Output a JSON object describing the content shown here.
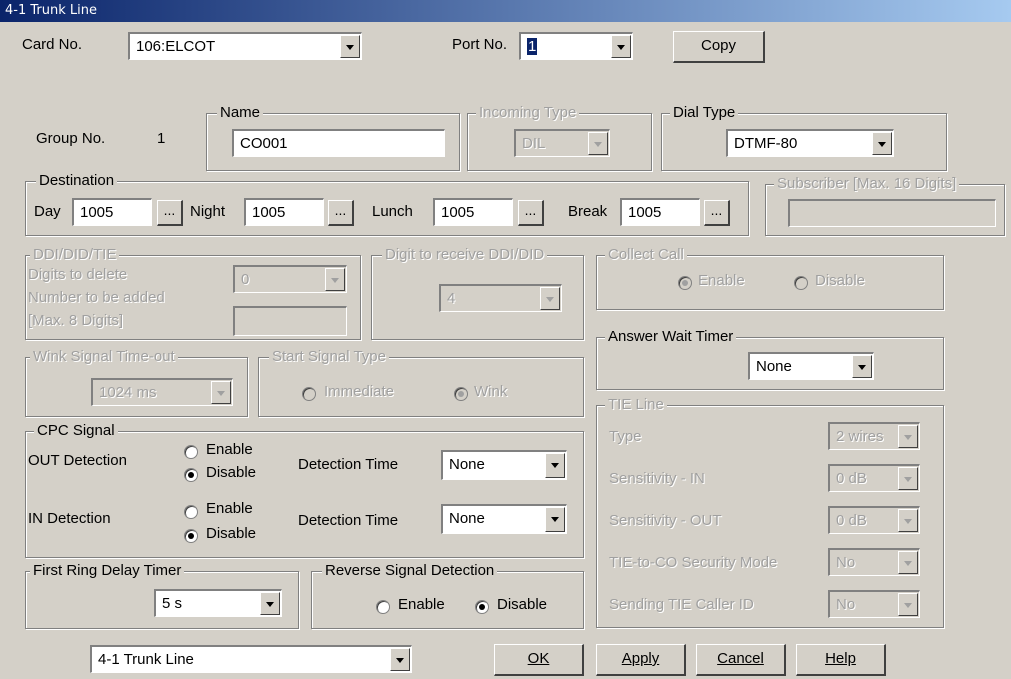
{
  "window": {
    "title": "4-1 Trunk Line"
  },
  "header": {
    "card_label": "Card No.",
    "card_value": "106:ELCOT",
    "port_label": "Port No.",
    "port_value": "1",
    "copy_label": "Copy",
    "group_label": "Group No.",
    "group_value": "1",
    "name_legend": "Name",
    "name_value": "CO001",
    "incoming_legend": "Incoming Type",
    "incoming_value": "DIL",
    "dialtype_legend": "Dial Type",
    "dialtype_value": "DTMF-80"
  },
  "destination": {
    "legend": "Destination",
    "day_label": "Day",
    "day_value": "1005",
    "night_label": "Night",
    "night_value": "1005",
    "lunch_label": "Lunch",
    "lunch_value": "1005",
    "break_label": "Break",
    "break_value": "1005",
    "browse_label": "..."
  },
  "subscriber": {
    "legend": "Subscriber [Max. 16 Digits]",
    "value": ""
  },
  "ddi": {
    "legend": "DDI/DID/TIE",
    "delete_label": "Digits to delete",
    "delete_value": "0",
    "add_label": "Number to be added",
    "add_label2": "[Max. 8 Digits]",
    "add_value": ""
  },
  "digit_receive": {
    "legend": "Digit to receive DDI/DID",
    "value": "4"
  },
  "collect_call": {
    "legend": "Collect Call",
    "enable": "Enable",
    "disable": "Disable"
  },
  "answer_wait": {
    "legend": "Answer Wait Timer",
    "value": "None"
  },
  "wink": {
    "legend": "Wink Signal Time-out",
    "value": "1024 ms"
  },
  "start_signal": {
    "legend": "Start Signal Type",
    "immediate": "Immediate",
    "wink": "Wink"
  },
  "cpc": {
    "legend": "CPC Signal",
    "out_label": "OUT Detection",
    "in_label": "IN Detection",
    "enable": "Enable",
    "disable": "Disable",
    "time_label": "Detection Time",
    "out_time": "None",
    "in_time": "None"
  },
  "tie_line": {
    "legend": "TIE Line",
    "type_label": "Type",
    "type_value": "2 wires",
    "sens_in_label": "Sensitivity - IN",
    "sens_in_value": "0 dB",
    "sens_out_label": "Sensitivity - OUT",
    "sens_out_value": "0 dB",
    "security_label": "TIE-to-CO Security Mode",
    "security_value": "No",
    "callerid_label": "Sending TIE Caller ID",
    "callerid_value": "No"
  },
  "first_ring": {
    "legend": "First Ring Delay Timer",
    "value": "5 s"
  },
  "reverse": {
    "legend": "Reverse Signal Detection",
    "enable": "Enable",
    "disable": "Disable"
  },
  "footer": {
    "page_select": "4-1 Trunk Line",
    "ok": "OK",
    "apply": "Apply",
    "cancel": "Cancel",
    "help": "Help"
  }
}
